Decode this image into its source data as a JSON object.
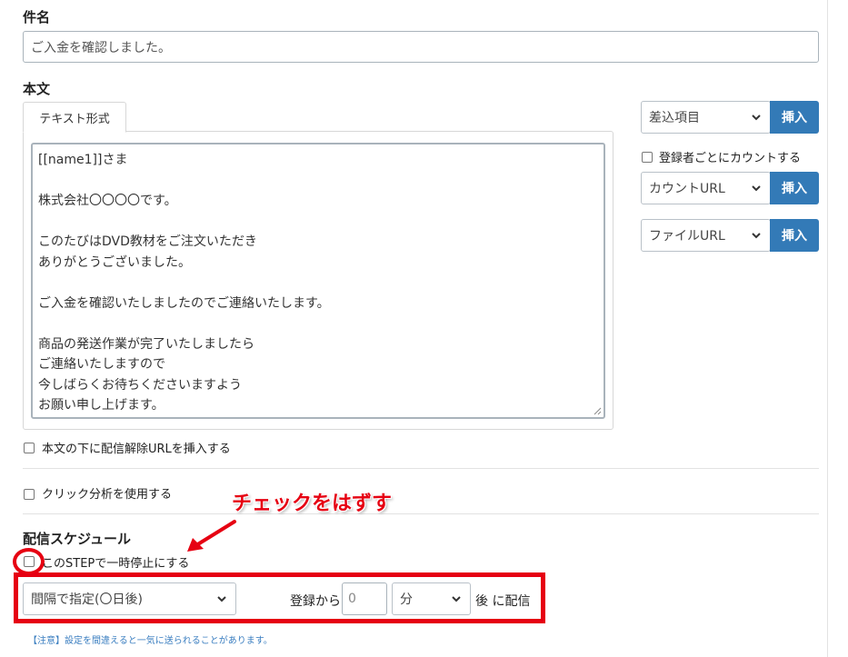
{
  "subject": {
    "label": "件名",
    "value": "ご入金を確認しました。"
  },
  "body": {
    "label": "本文",
    "tab_label": "テキスト形式",
    "lines": [
      "[[name1]]さま",
      "",
      "株式会社〇〇〇〇です。",
      "",
      "このたびはDVD教材をご注文いただき",
      "ありがとうございました。",
      "",
      "ご入金を確認いたしましたのでご連絡いたします。",
      "",
      "商品の発送作業が完了いたしましたら",
      "ご連絡いたしますので",
      "今しばらくお待ちくださいますよう",
      "お願い申し上げます。"
    ]
  },
  "insert_panel": {
    "merge_select": "差込項目",
    "count_checkbox_label": "登録者ごとにカウントする",
    "count_url_select": "カウントURL",
    "file_url_select": "ファイルURL",
    "insert_label": "挿入"
  },
  "options": {
    "unsubscribe_label": "本文の下に配信解除URLを挿入する",
    "click_analysis_label": "クリック分析を使用する"
  },
  "schedule": {
    "label": "配信スケジュール",
    "pause_label": "このSTEPで一時停止にする",
    "interval_select": "間隔で指定(〇日後)",
    "from_registration": "登録から",
    "number_value": "0",
    "unit_select": "分",
    "after_label": "後 に配信",
    "note": "【注意】設定を間違えると一気に送られることがあります。"
  },
  "annotation": {
    "text": "チェックをはずす",
    "color": "#e60012"
  },
  "colors": {
    "primary": "#337ab7",
    "annotation_red": "#e60012"
  }
}
